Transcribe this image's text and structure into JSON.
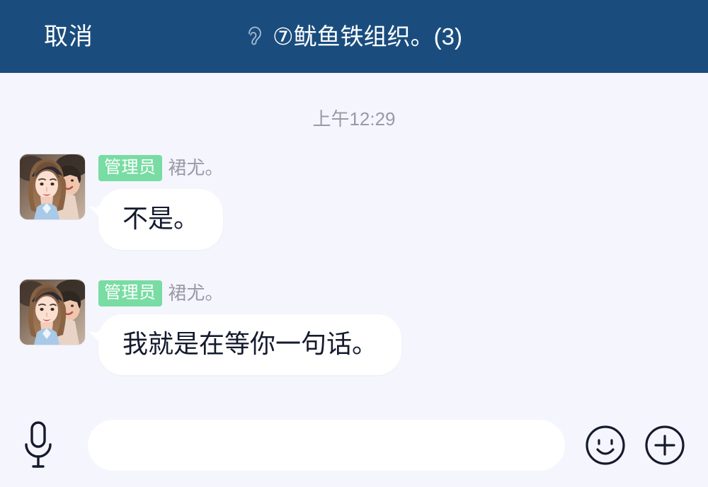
{
  "header": {
    "cancel_label": "取消",
    "title": "⑦鱿鱼铁组织。(3)",
    "ear_icon_name": "ear-icon",
    "background_color": "#1a4d7e",
    "text_color": "#ffffff"
  },
  "chat": {
    "background_color": "#f5f5fd",
    "timestamp": "上午12:29",
    "messages": [
      {
        "badge": "管理员",
        "sender": "裙尤。",
        "text": "不是。",
        "bubble_color": "#ffffff",
        "badge_color": "#79dca3"
      },
      {
        "badge": "管理员",
        "sender": "裙尤。",
        "text": "我就是在等你一句话。",
        "bubble_color": "#ffffff",
        "badge_color": "#79dca3"
      }
    ]
  },
  "input_bar": {
    "mic_icon_name": "microphone-icon",
    "message_value": "",
    "message_placeholder": "",
    "emoji_icon_name": "smiley-face-icon",
    "add_icon_name": "plus-circle-icon"
  }
}
